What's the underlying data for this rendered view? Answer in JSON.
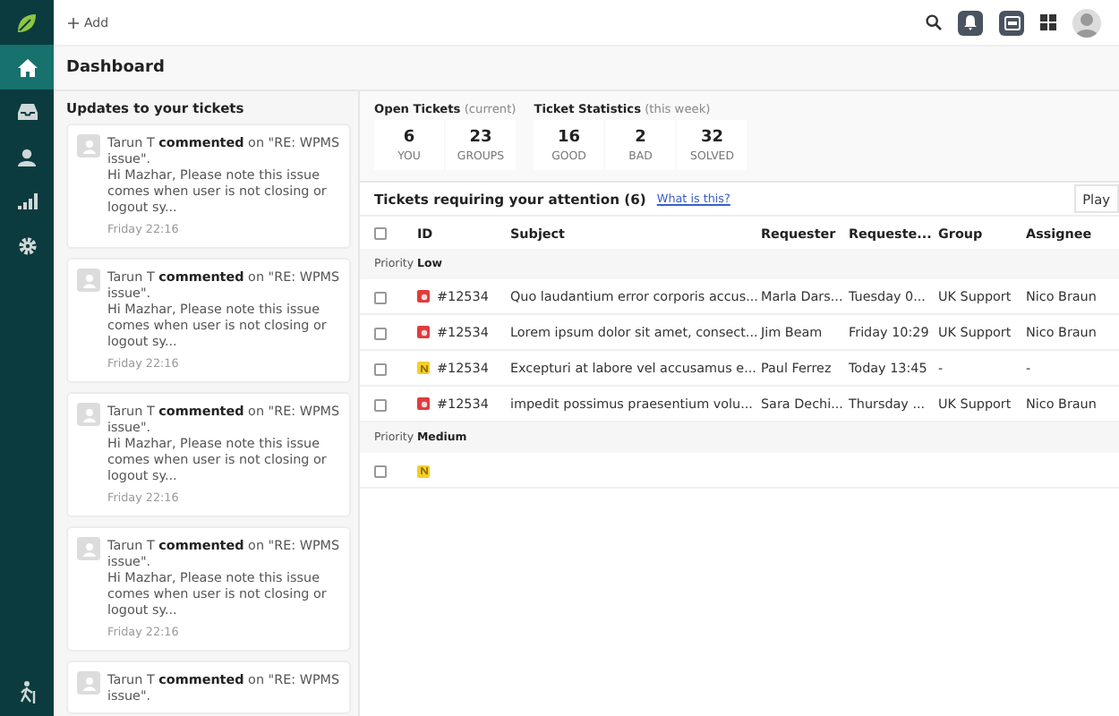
{
  "topbar": {
    "add_label": "Add"
  },
  "nav": [
    {
      "selected": true
    },
    {
      "selected": false
    },
    {
      "selected": false
    },
    {
      "selected": false
    },
    {
      "selected": false
    }
  ],
  "page_title": "Dashboard",
  "updates": {
    "title": "Updates to your tickets",
    "items": [
      {
        "headline": "Tarun T **commented** on \"RE: WPMS issue\".",
        "body": "Hi Mazhar, Please note this issue comes when user is not closing or logout sy...",
        "time": "Friday 22:16"
      },
      {
        "headline": "Tarun T **commented** on \"RE: WPMS issue\".",
        "body": "Hi Mazhar, Please note this issue comes when user is not closing or logout sy...",
        "time": "Friday 22:16"
      },
      {
        "headline": "Tarun T **commented** on \"RE: WPMS issue\".",
        "body": "Hi Mazhar, Please note this issue comes when user is not closing or logout sy...",
        "time": "Friday 22:16"
      },
      {
        "headline": "Tarun T **commented** on \"RE: WPMS issue\".",
        "body": "Hi Mazhar, Please note this issue comes when user is not closing or logout sy...",
        "time": "Friday 22:16"
      },
      {
        "headline": "Tarun T **commented** on \"RE: WPMS issue\"."
      }
    ]
  },
  "stat_groups": [
    {
      "title": "Open Tickets",
      "note": "(current)",
      "stats": [
        {
          "value": "6",
          "label": "YOU"
        },
        {
          "value": "23",
          "label": "GROUPS"
        }
      ]
    },
    {
      "title": "Ticket Statistics",
      "note": "(this week)",
      "stats": [
        {
          "value": "16",
          "label": "GOOD"
        },
        {
          "value": "2",
          "label": "BAD"
        },
        {
          "value": "32",
          "label": "SOLVED"
        }
      ]
    }
  ],
  "attention": {
    "title": "Tickets requiring your attention (6)",
    "link": "What is this?",
    "button": "Play",
    "select_all_checked": false,
    "columns": [
      "ID",
      "Subject",
      "Requester",
      "Requeste...",
      "Group",
      "Assignee"
    ],
    "groups": [
      {
        "label": "Priority",
        "value": "Low",
        "rows": [
          {
            "kind": "open",
            "checked": false,
            "id": "#12534",
            "cells": [
              "Quo laudantium error corporis accus...",
              "Marla Dars...",
              "Tuesday 0...",
              "UK Support",
              "Nico Braun"
            ]
          },
          {
            "kind": "open",
            "checked": false,
            "id": "#12534",
            "cells": [
              "Lorem ipsum dolor sit amet, consect...",
              "Jim Beam",
              "Friday 10:29",
              "UK Support",
              "Nico Braun"
            ]
          },
          {
            "kind": "new",
            "checked": false,
            "id": "#12534",
            "cells": [
              "Excepturi at labore vel accusamus e...",
              "Paul Ferrez",
              "Today 13:45",
              "-",
              "-"
            ]
          },
          {
            "kind": "open",
            "checked": false,
            "id": "#12534",
            "cells": [
              "impedit possimus praesentium volu...",
              "Sara Dechi...",
              "Thursday ...",
              "UK Support",
              "Nico Braun"
            ]
          }
        ]
      },
      {
        "label": "Priority",
        "value": "Medium",
        "rows": [
          {
            "kind": "new",
            "checked": false,
            "cells": []
          }
        ]
      }
    ]
  }
}
